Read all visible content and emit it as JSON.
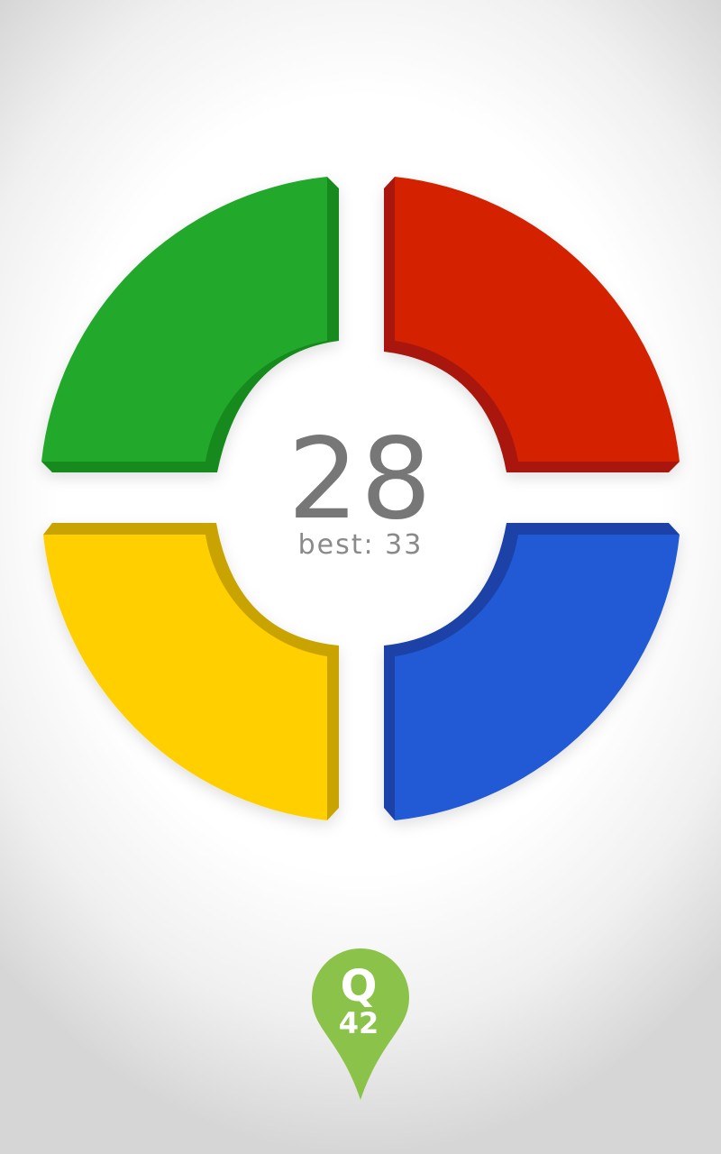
{
  "game": {
    "score": "28",
    "best_label": "best:",
    "best_value": "33"
  },
  "pads": [
    {
      "name": "green",
      "color": "#22a82c",
      "shade": "#168a1f"
    },
    {
      "name": "red",
      "color": "#d42306",
      "shade": "#a8180a"
    },
    {
      "name": "yellow",
      "color": "#ffcf00",
      "shade": "#c9a400"
    },
    {
      "name": "blue",
      "color": "#225ad6",
      "shade": "#1a43a8"
    }
  ],
  "logo": {
    "letter": "Q",
    "number": "42",
    "color": "#8bc34a",
    "icon": "map-pin-icon"
  }
}
